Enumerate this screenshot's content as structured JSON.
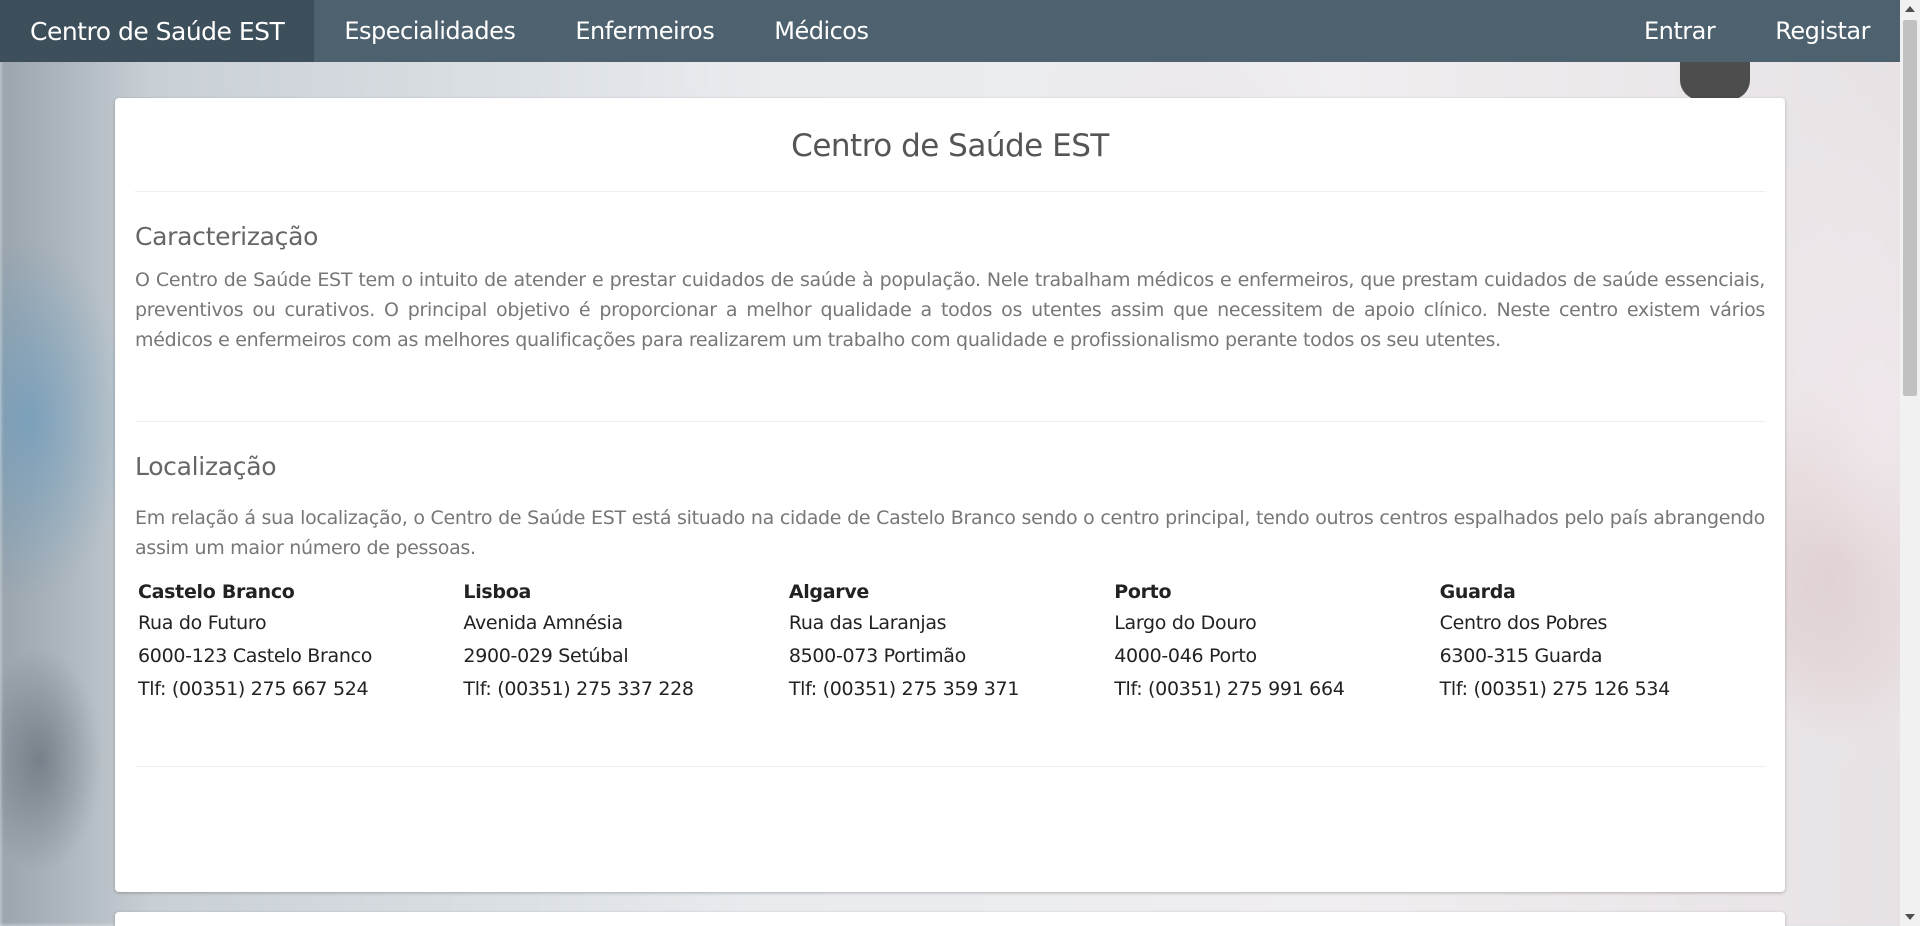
{
  "navbar": {
    "brand": "Centro de Saúde EST",
    "items": [
      "Especialidades",
      "Enfermeiros",
      "Médicos"
    ],
    "right_items": [
      "Entrar",
      "Registar"
    ]
  },
  "main": {
    "title": "Centro de Saúde EST",
    "sections": [
      {
        "title": "Caracterização",
        "text": "O Centro de Saúde EST tem o intuito de atender e prestar cuidados de saúde à população. Nele trabalham médicos e enfermeiros, que prestam cuidados de saúde essenciais, preventivos ou curativos. O principal objetivo é proporcionar a melhor qualidade a todos os utentes assim que necessitem de apoio clínico. Neste centro existem vários médicos e enfermeiros com as melhores qualificações para realizarem um trabalho com qualidade e profissionalismo perante todos os seu utentes."
      },
      {
        "title": "Localização",
        "text": "Em relação á sua localização, o Centro de Saúde EST está situado na cidade de Castelo Branco sendo o centro principal, tendo outros centros espalhados pelo país abrangendo assim um maior número de pessoas."
      }
    ],
    "locations": [
      {
        "city": "Castelo Branco",
        "street": "Rua do Futuro",
        "postal": "6000-123 Castelo Branco",
        "phone": "Tlf: (00351) 275 667 524"
      },
      {
        "city": "Lisboa",
        "street": "Avenida Amnésia",
        "postal": "2900-029 Setúbal",
        "phone": "Tlf: (00351) 275 337 228"
      },
      {
        "city": "Algarve",
        "street": "Rua das Laranjas",
        "postal": "8500-073 Portimão",
        "phone": "Tlf: (00351) 275 359 371"
      },
      {
        "city": "Porto",
        "street": "Largo do Douro",
        "postal": "4000-046 Porto",
        "phone": "Tlf: (00351) 275 991 664"
      },
      {
        "city": "Guarda",
        "street": "Centro dos Pobres",
        "postal": "6300-315 Guarda",
        "phone": "Tlf: (00351) 275 126 534"
      }
    ]
  },
  "colors": {
    "navbar": "#4e616e",
    "navbar_brand": "#3d4f5b",
    "card": "#ffffff"
  }
}
